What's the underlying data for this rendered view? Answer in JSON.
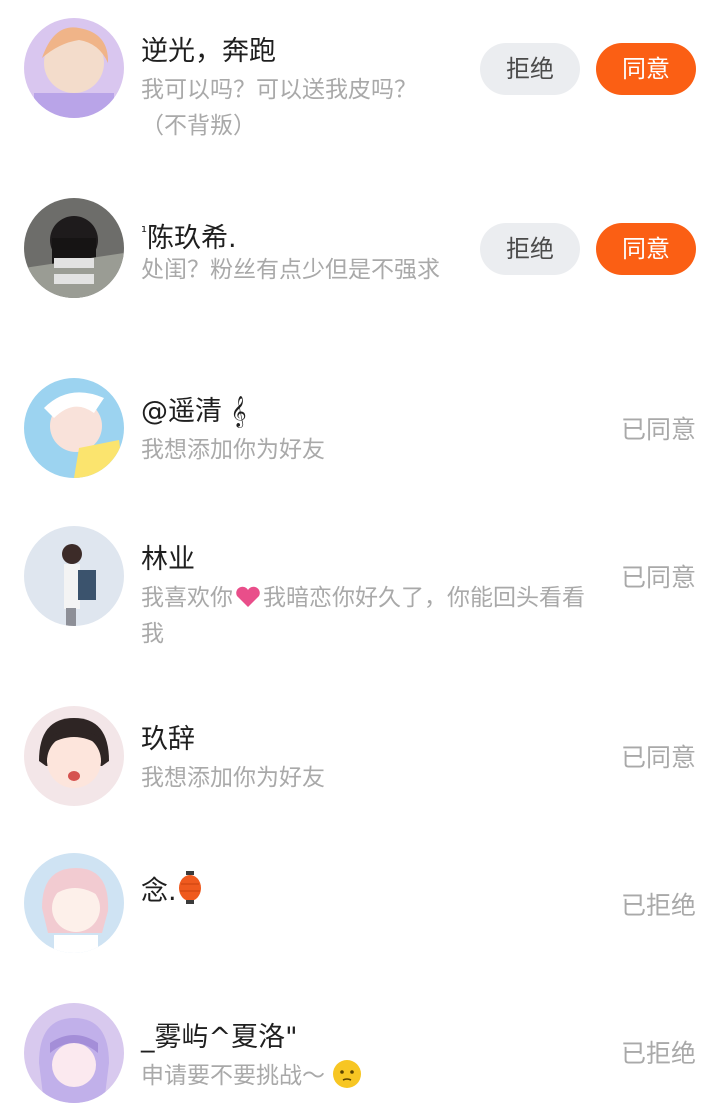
{
  "requests": [
    {
      "name": "逆光，奔跑",
      "message": "我可以吗？可以送我皮吗？（不背叛）",
      "reject_label": "拒绝",
      "accept_label": "同意"
    },
    {
      "name_prefix": "¹",
      "name": "陈玖希.",
      "message": "处闺？粉丝有点少但是不强求",
      "reject_label": "拒绝",
      "accept_label": "同意"
    },
    {
      "name": "@遥清",
      "name_symbol": "𝄞",
      "message": "我想添加你为好友",
      "status": "已同意"
    },
    {
      "name": "林业",
      "message_part1": "我喜欢你",
      "message_part2": "我暗恋你好久了，你能回头看看我",
      "status": "已同意"
    },
    {
      "name": "玖辞",
      "message": "我想添加你为好友",
      "status": "已同意"
    },
    {
      "name": "念.",
      "status": "已拒绝"
    },
    {
      "name": "_雾屿^夏洛\"",
      "message": "申请要不要挑战～",
      "status": "已拒绝"
    }
  ],
  "colors": {
    "accent": "#fb5f14",
    "reject_bg": "#ebedf0",
    "secondary_text": "#a9a9a9",
    "primary_text": "#1f1f1f"
  },
  "icons": [
    "heart-emoji-icon",
    "lantern-emoji-icon",
    "smiley-emoji-icon"
  ]
}
